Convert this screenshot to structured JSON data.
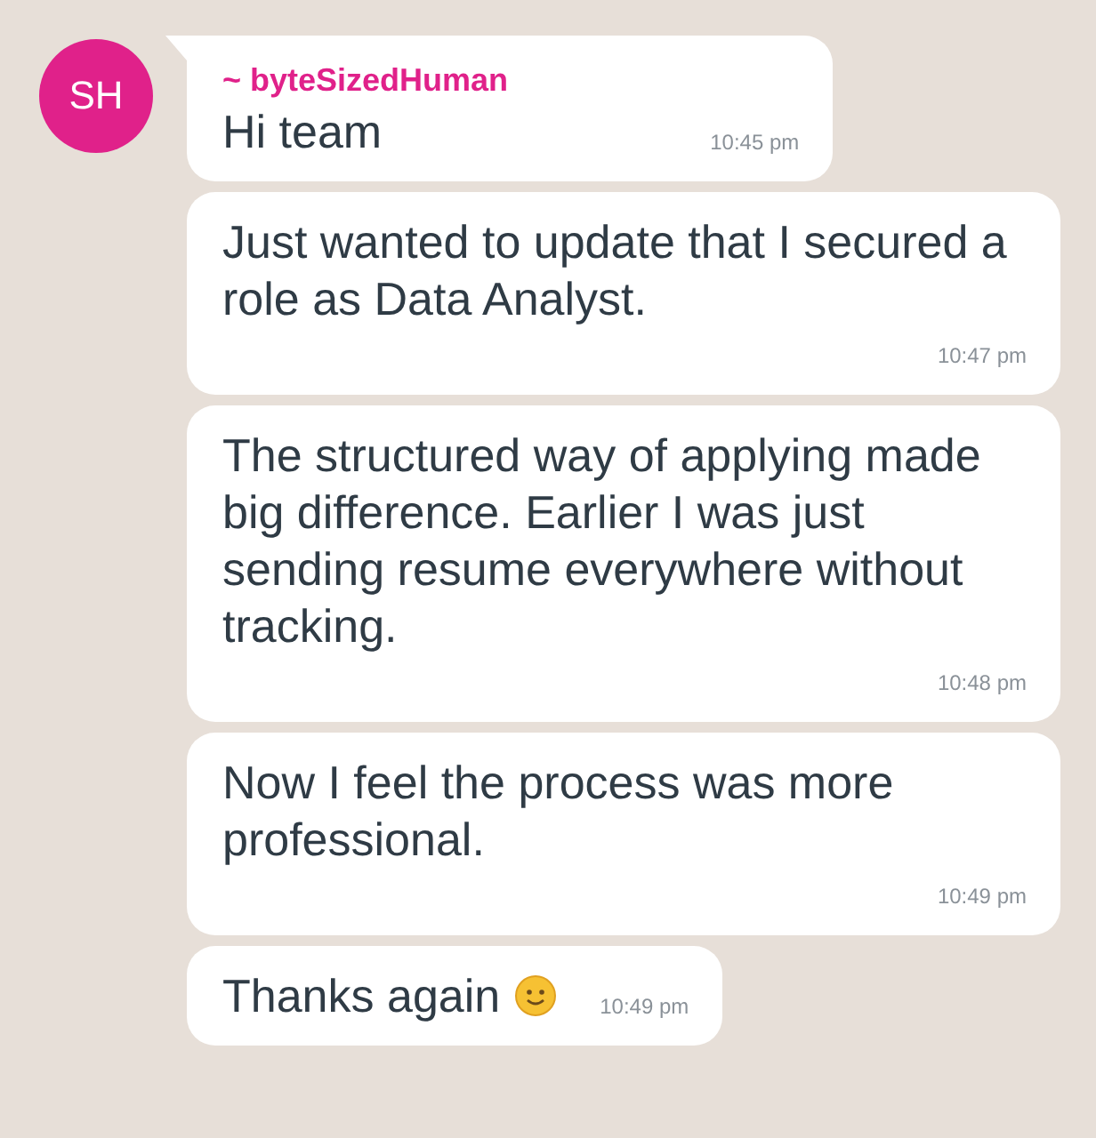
{
  "avatar": {
    "initials": "SH"
  },
  "messages": [
    {
      "sender": "~ byteSizedHuman",
      "text": "Hi team",
      "time": "10:45 pm",
      "emoji": false
    },
    {
      "text": "Just wanted to update that I secured a role as Data Analyst.",
      "time": "10:47 pm",
      "emoji": false
    },
    {
      "text": "The structured way of applying made big difference. Earlier I was just sending resume everywhere without tracking.",
      "time": "10:48 pm",
      "emoji": false
    },
    {
      "text": "Now I feel the process was more professional.",
      "time": "10:49 pm",
      "emoji": false
    },
    {
      "text": "Thanks again",
      "time": "10:49 pm",
      "emoji": true
    }
  ]
}
